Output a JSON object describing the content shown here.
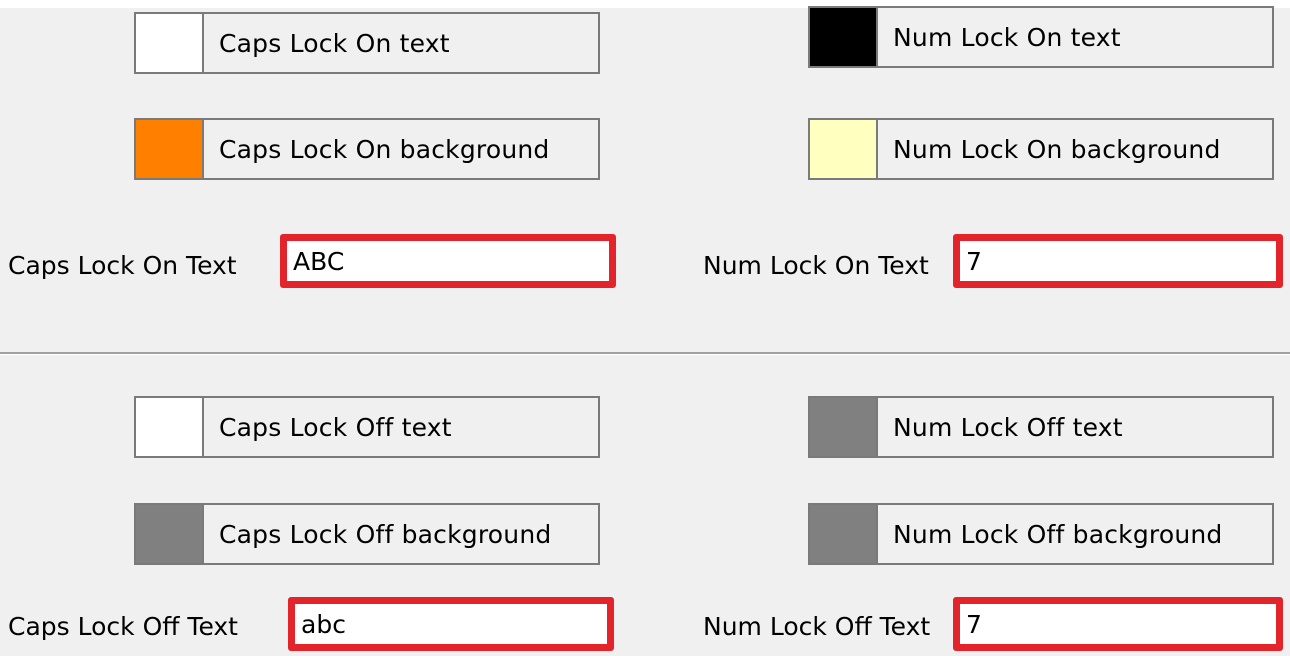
{
  "caps_on": {
    "text_color_button": {
      "label": "Caps Lock On text",
      "swatch": "#ffffff"
    },
    "background_button": {
      "label": "Caps Lock On background",
      "swatch": "#ff8000"
    },
    "field_label": "Caps Lock On Text",
    "field_value": "ABC"
  },
  "num_on": {
    "text_color_button": {
      "label": "Num Lock On text",
      "swatch": "#000000"
    },
    "background_button": {
      "label": "Num Lock On background",
      "swatch": "#ffffc0"
    },
    "field_label": "Num Lock On Text",
    "field_value": "7"
  },
  "caps_off": {
    "text_color_button": {
      "label": "Caps Lock Off text",
      "swatch": "#ffffff"
    },
    "background_button": {
      "label": "Caps Lock Off background",
      "swatch": "#808080"
    },
    "field_label": "Caps Lock Off Text",
    "field_value": "abc"
  },
  "num_off": {
    "text_color_button": {
      "label": "Num Lock Off text",
      "swatch": "#808080"
    },
    "background_button": {
      "label": "Num Lock Off background",
      "swatch": "#808080"
    },
    "field_label": "Num Lock Off Text",
    "field_value": "7"
  },
  "highlight_color": "#e3242b"
}
